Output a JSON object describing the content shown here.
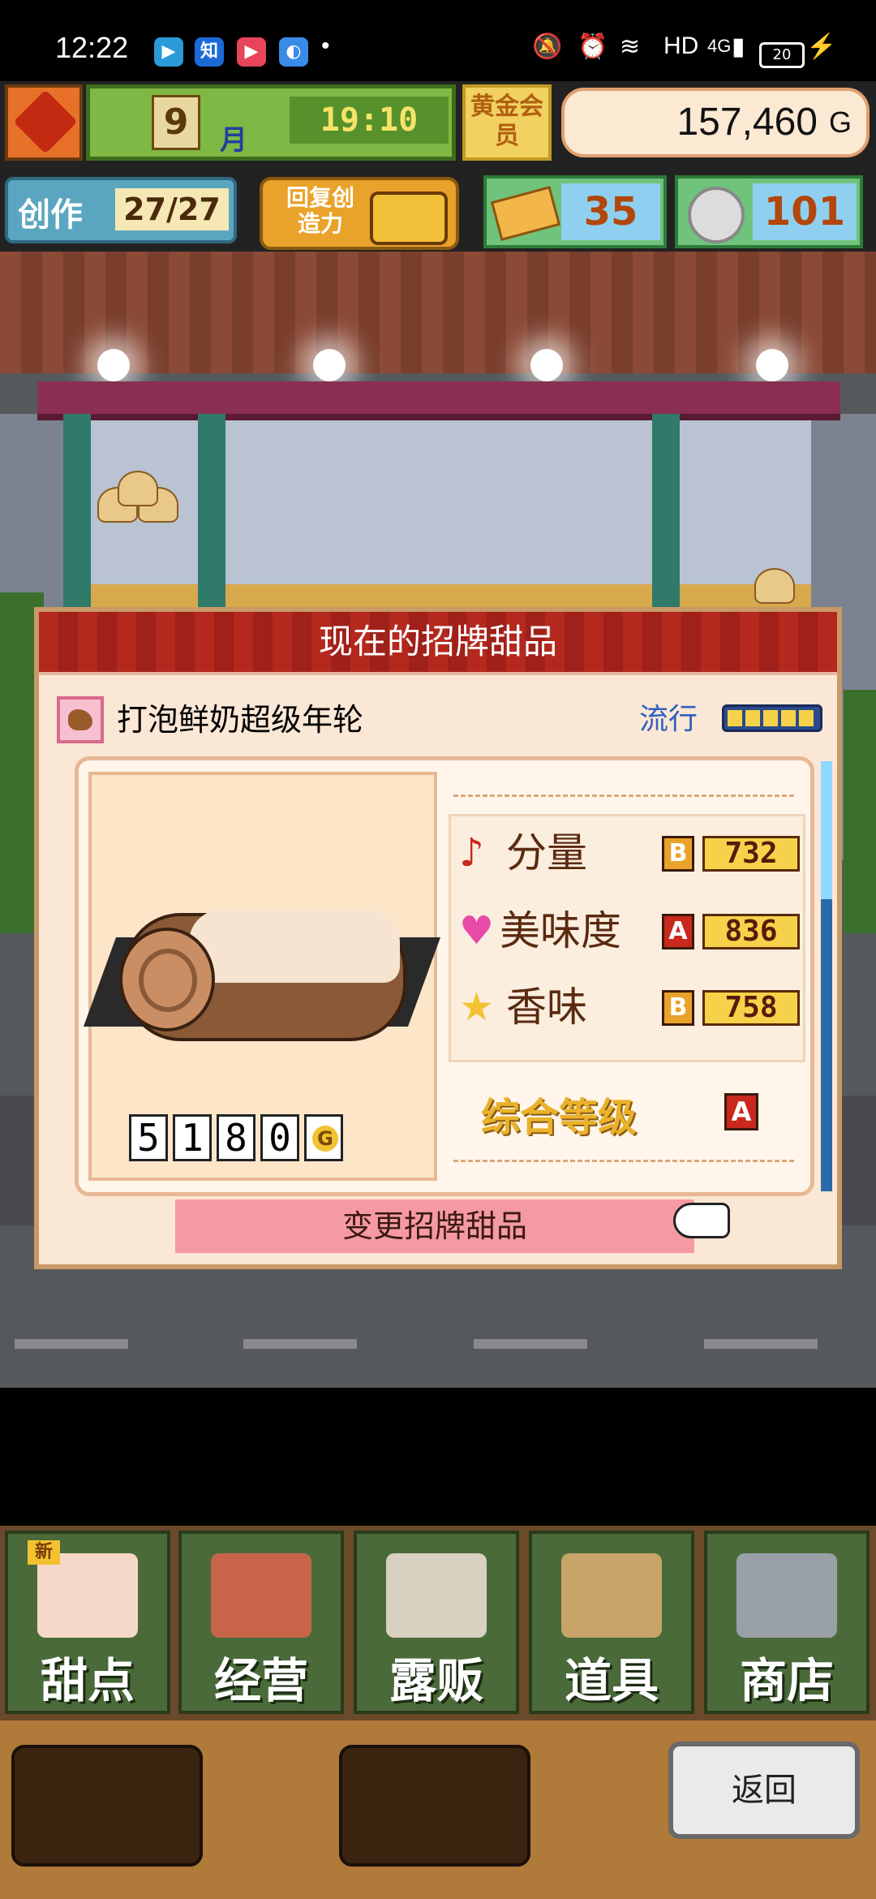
{
  "status_bar": {
    "time": "12:22",
    "network": "HD",
    "cellular": "4G",
    "battery": "20"
  },
  "hud": {
    "month": "9",
    "month_unit": "月",
    "clock": "19:10",
    "gold_badge": "黄金会员",
    "money": "157,460",
    "money_unit": "G",
    "create_label": "创作",
    "create_value": "27/27",
    "restore_label": "回复创造力",
    "tickets": "35",
    "medals": "101"
  },
  "panel": {
    "title": "现在的招牌甜品",
    "dessert_name": "打泡鲜奶超级年轮",
    "trend_label": "流行",
    "trend_level": 1.0,
    "price_digits": [
      "5",
      "1",
      "8",
      "0"
    ],
    "price_unit": "G",
    "stats": [
      {
        "icon": "music-note-icon",
        "name": "分量",
        "grade": "B",
        "value": "732"
      },
      {
        "icon": "heart-icon",
        "name": "美味度",
        "grade": "A",
        "value": "836"
      },
      {
        "icon": "star-icon",
        "name": "香味",
        "grade": "B",
        "value": "758"
      }
    ],
    "overall_label": "综合等级",
    "overall_grade": "A",
    "change_button": "变更招牌甜品"
  },
  "menu": {
    "tabs": [
      {
        "label": "甜点",
        "badge": "新",
        "icon": "cake-icon"
      },
      {
        "label": "经营",
        "icon": "shop-icon"
      },
      {
        "label": "露贩",
        "icon": "food-truck-icon"
      },
      {
        "label": "道具",
        "icon": "items-bag-icon"
      },
      {
        "label": "商店",
        "icon": "shopping-cart-icon"
      }
    ],
    "back_button": "返回"
  },
  "colors": {
    "title_bar": "#b4281e",
    "grade_a": "#c8281e",
    "grade_b": "#e9a22a",
    "change_button": "#f59aa4",
    "menu_tab": "#4a6a3a"
  }
}
